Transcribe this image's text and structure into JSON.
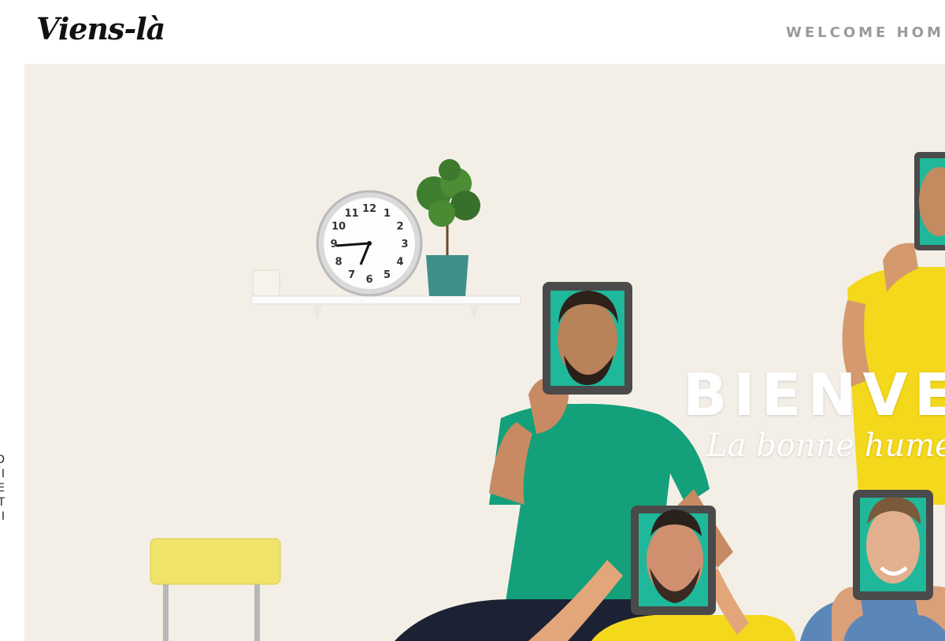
{
  "header": {
    "logo_text": "Viens-là",
    "nav_items": [
      {
        "label": "WELCOME HOME"
      }
    ]
  },
  "side": {
    "vertical_letters": [
      "D",
      "I",
      "E",
      "T",
      "I"
    ]
  },
  "hero": {
    "title": "BIENVEN",
    "subtitle": "La bonne humeur a",
    "clock_numerals": [
      "12",
      "1",
      "2",
      "3",
      "4",
      "5",
      "6",
      "7",
      "8",
      "9",
      "10",
      "11"
    ]
  },
  "colors": {
    "wall": "#f3efe7",
    "shirt_green": "#14a07a",
    "shirt_yellow": "#f4d81c",
    "shirt_blue": "#5b87b8",
    "chair_yellow": "#efe36a",
    "pot_teal": "#3f8f8b",
    "nav_gray": "#9a9a9a"
  }
}
